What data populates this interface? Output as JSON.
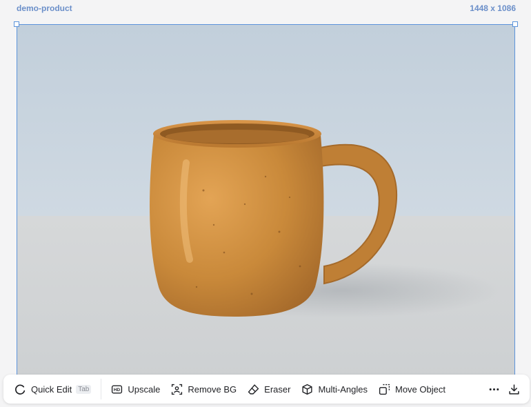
{
  "header": {
    "layer_name": "demo-product",
    "dimensions": "1448 x 1086"
  },
  "canvas": {
    "content": "photo",
    "colors": {
      "selection": "#5b93db",
      "wall": "#c6d3df",
      "floor": "#d4d6d7",
      "mug": "#c98a3b"
    }
  },
  "toolbar": {
    "quick_edit": {
      "label": "Quick Edit",
      "shortcut": "Tab",
      "icon": "refresh-icon"
    },
    "upscale": {
      "label": "Upscale",
      "icon": "hd-icon"
    },
    "remove_bg": {
      "label": "Remove BG",
      "icon": "person-frame-icon"
    },
    "eraser": {
      "label": "Eraser",
      "icon": "eraser-icon"
    },
    "multi_angles": {
      "label": "Multi-Angles",
      "icon": "cube-icon"
    },
    "move_object": {
      "label": "Move Object",
      "icon": "move-frame-icon"
    },
    "more": {
      "icon": "more-icon"
    },
    "download": {
      "icon": "download-icon"
    }
  }
}
